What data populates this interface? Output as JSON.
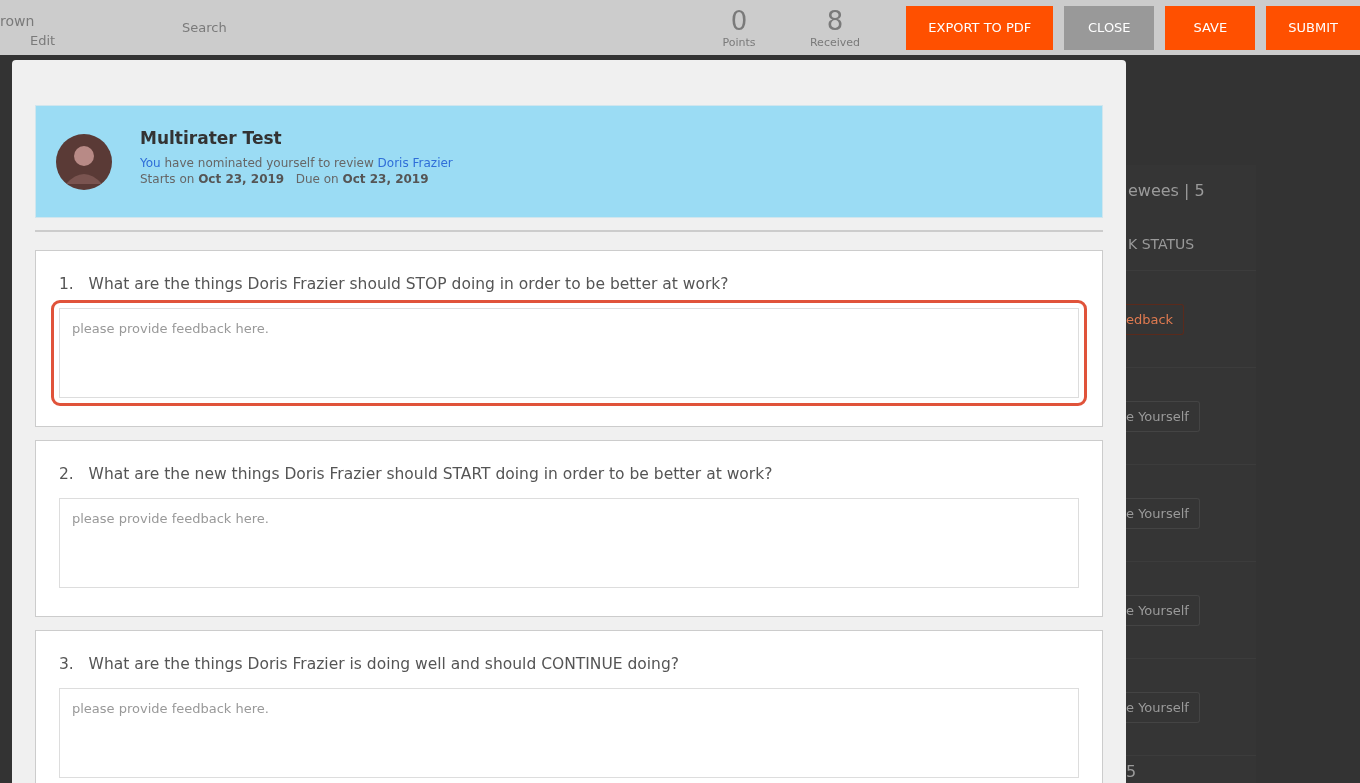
{
  "top_bar": {
    "user_name": "rown",
    "edit_link": "Edit",
    "search": {
      "placeholder": "Search"
    },
    "stats": [
      {
        "value": "0",
        "label": "Points"
      },
      {
        "value": "8",
        "label": "Received"
      }
    ],
    "buttons": [
      {
        "label": "EXPORT TO PDF",
        "kind": "primary"
      },
      {
        "label": "CLOSE",
        "kind": "secondary"
      },
      {
        "label": "SAVE",
        "kind": "primary"
      },
      {
        "label": "SUBMIT",
        "kind": "primary"
      }
    ]
  },
  "background": {
    "panel": {
      "title": "ewees | 5",
      "column": "K STATUS",
      "rows": [
        {
          "action": "edback",
          "kind": "highlight"
        },
        {
          "action": "e Yourself",
          "kind": "plain"
        },
        {
          "action": "e Yourself",
          "kind": "plain"
        },
        {
          "action": "e Yourself",
          "kind": "plain"
        },
        {
          "action": "e Yourself",
          "kind": "plain"
        }
      ],
      "page": "5"
    }
  },
  "modal": {
    "review": {
      "title": "Multirater Test",
      "actor": "You",
      "nomination": "have nominated yourself to review",
      "reviewee": "Doris Frazier",
      "dates": "Starts on **Oct 23, 2019**   Due on **Oct 23, 2019**"
    },
    "questions": [
      {
        "number": "1.",
        "text": "What are the things Doris Frazier should STOP doing in order to be better at work?",
        "placeholder": "please provide feedback here.",
        "focused": true
      },
      {
        "number": "2.",
        "text": "What are the new things Doris Frazier should START doing in order to be better at work?",
        "placeholder": "please provide feedback here.",
        "focused": false
      },
      {
        "number": "3.",
        "text": "What are the things Doris Frazier is doing well and should CONTINUE doing?",
        "placeholder": "please provide feedback here.",
        "focused": false
      }
    ]
  }
}
